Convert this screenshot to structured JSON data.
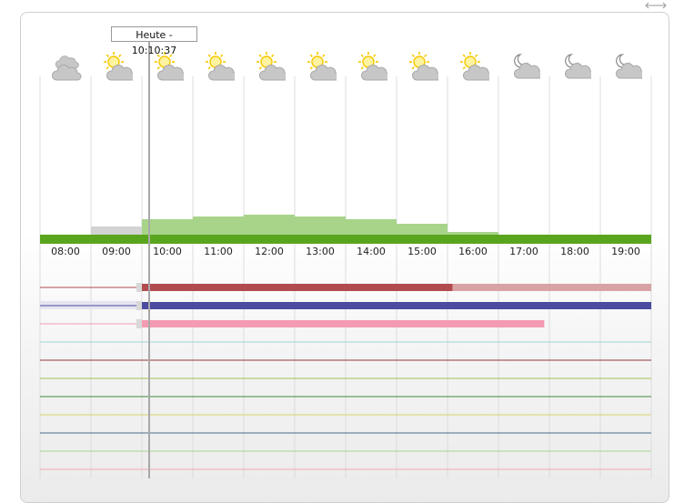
{
  "tooltip": {
    "label": "Heute - 10:10:37"
  },
  "hours": [
    "08:00",
    "09:00",
    "10:00",
    "11:00",
    "12:00",
    "13:00",
    "14:00",
    "15:00",
    "16:00",
    "17:00",
    "18:00",
    "19:00"
  ],
  "weather_icons": [
    "cloud",
    "sun-cloud",
    "sun-cloud",
    "sun-cloud",
    "sun-cloud",
    "sun-cloud",
    "sun-cloud",
    "sun-cloud",
    "sun-cloud",
    "moon-cloud",
    "moon-cloud",
    "moon-cloud"
  ],
  "colors": {
    "green": "#5aa51e",
    "green_light": "#a8d48a",
    "red": "#b24b4f",
    "red_light": "#d9a3a5",
    "blue": "#4b4ba0",
    "pink": "#f39bb0",
    "sun": "#f5c800",
    "cloud": "#bfbfbf"
  },
  "now_fraction_hours": 10.17,
  "bars_relative_level": [
    0,
    0.25,
    0.5,
    0.6,
    0.65,
    0.6,
    0.5,
    0.35,
    0.1,
    0,
    0,
    0
  ],
  "tracks": [
    {
      "color": "#b24b4f",
      "light": "#d9a3a5",
      "start": 10.0,
      "solid_end": 16.1,
      "end": 20.0
    },
    {
      "color": "#4b4ba0",
      "light": "#4b4ba0",
      "start": 10.0,
      "solid_end": 20.0,
      "end": 20.0
    },
    {
      "color": "#f39bb0",
      "light": "#f39bb0",
      "start": 10.0,
      "solid_end": 17.9,
      "end": 17.9
    }
  ],
  "empty_lines": [
    "#9fd6d8",
    "#8e3a3f",
    "#a3c44b",
    "#3d8c3a",
    "#d8d46a",
    "#4a6c8a",
    "#a9d58e",
    "#f2a9b2"
  ]
}
